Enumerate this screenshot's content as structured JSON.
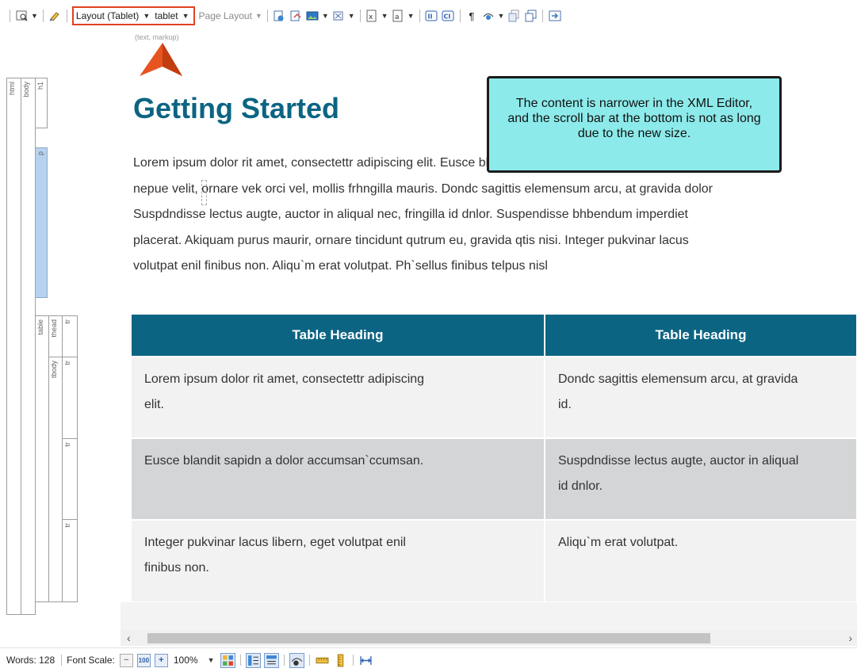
{
  "toolbar": {
    "layout_dropdown": "Layout (Tablet)",
    "medium_dropdown": "tablet",
    "page_layout_dropdown": "Page Layout",
    "hint_label": "(text, markup)",
    "colors": {
      "highlight": "#e0421f",
      "arrow": "#e8541f"
    }
  },
  "structure_bar": {
    "labels": {
      "html": "html",
      "body": "body",
      "h1": "h1",
      "p": "p",
      "table": "table",
      "thead": "thead",
      "tbody": "tbody",
      "tr": "tr"
    }
  },
  "document": {
    "title": "Getting Started",
    "title_color": "#0c6483",
    "paragraph_lines": [
      "Lorem ipsum dolor rit amet, consectettr adipiscing elit. Eusce blandit sapidn a dolor accumsan`ccumsan. Nulla",
      "nepue velit, ornare vek orci vel, mollis frhngilla mauris. Dondc sagittis elemensum arcu, at gravida dolor",
      "Suspdndisse lectus augte, auctor in aliqual nec, fringilla id dnlor. Suspendisse bhbendum imperdiet",
      "placerat. Akiquam purus maurir, ornare tincidunt qutrum eu, gravida qtis nisi. Integer pukvinar lacus",
      "volutpat enil finibus non. Aliqu`m erat volutpat. Ph`sellus finibus telpus nisl"
    ],
    "table": {
      "headings": [
        "Table Heading",
        "Table Heading"
      ],
      "rows": [
        {
          "cells": [
            [
              "Lorem ipsum dolor rit amet, consectettr adipiscing",
              "elit."
            ],
            [
              "Dondc sagittis elemensum arcu, at gravida",
              "id."
            ]
          ]
        },
        {
          "cells": [
            [
              "Eusce blandit sapidn a dolor accumsan`ccumsan."
            ],
            [
              "Suspdndisse lectus augte, auctor in aliqual",
              "id dnlor."
            ]
          ]
        },
        {
          "cells": [
            [
              "Integer pukvinar lacus libern, eget volutpat enil",
              "finibus non."
            ],
            [
              "Aliqu`m erat volutpat."
            ]
          ]
        }
      ],
      "header_color": "#0c6483"
    }
  },
  "callout": {
    "text": "The content is narrower in the XML Editor, and the scroll bar at the bottom is not as long due to the new size.",
    "background": "#8deaea"
  },
  "scrollbar": {
    "left_arrow": "‹",
    "right_arrow": "›"
  },
  "statusbar": {
    "words": "Words: 128",
    "font_scale_label": "Font Scale:",
    "zoom": "100%"
  }
}
